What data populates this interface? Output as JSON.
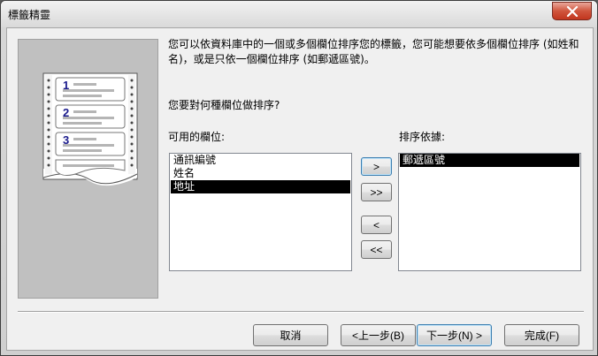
{
  "window": {
    "title": "標籤精靈"
  },
  "wizard": {
    "description": "您可以依資料庫中的一個或多個欄位排序您的標籤，您可能想要依多個欄位排序 (如姓和名)，或是只依一個欄位排序 (如郵遞區號)。",
    "question": "您要對何種欄位做排序?",
    "available_label": "可用的欄位:",
    "sort_label": "排序依據:",
    "available_fields": [
      {
        "text": "通訊編號",
        "selected": false
      },
      {
        "text": "姓名",
        "selected": false
      },
      {
        "text": "地址",
        "selected": true
      }
    ],
    "sort_fields": [
      {
        "text": "郵遞區號",
        "selected": true
      }
    ],
    "illustration_numbers": [
      "1",
      "2",
      "3"
    ]
  },
  "move_buttons": {
    "add": ">",
    "add_all": ">>",
    "remove": "<",
    "remove_all": "<<"
  },
  "buttons": {
    "cancel": "取消",
    "back": "<上一步(B)",
    "next": "下一步(N) >",
    "finish": "完成(F)"
  },
  "colors": {
    "selection": "#000000",
    "close_button": "#c2361e",
    "illustration_number": "#1a1a8c"
  }
}
